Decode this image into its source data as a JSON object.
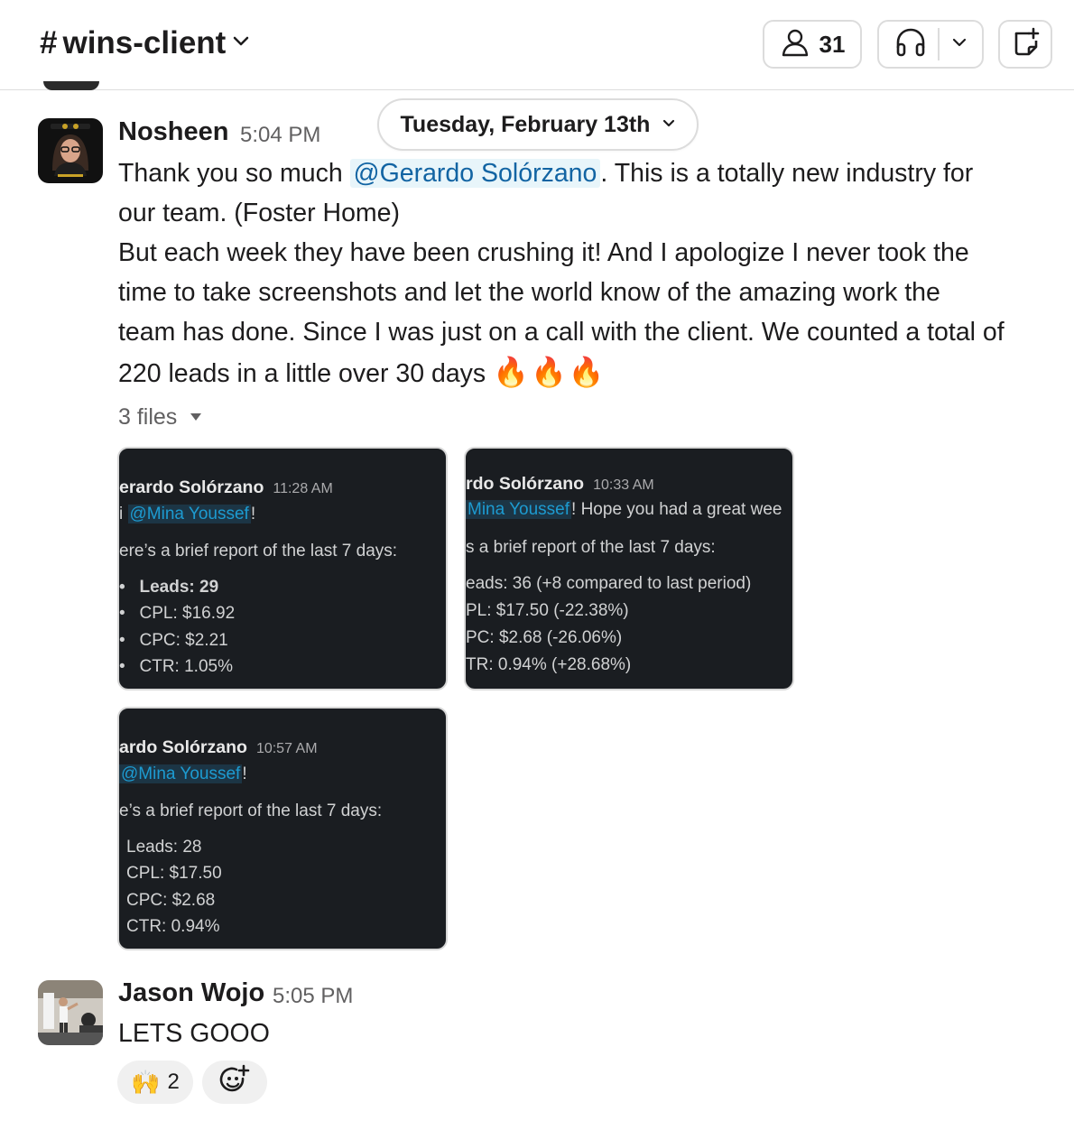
{
  "header": {
    "channel_hash": "#",
    "channel_name": "wins-client",
    "member_count": "31"
  },
  "date_divider": "Tuesday, February 13th",
  "messages": [
    {
      "author": "Nosheen",
      "time": "5:04 PM",
      "text_before": "Thank you so much ",
      "mention": "@Gerardo Solórzano",
      "text_after": ". This is a totally new industry for",
      "line2": "our team. (Foster Home)",
      "line3": "But each week they have been crushing it! And I apologize I never took the",
      "line4": "time to take screenshots and let the world know of the amazing work the",
      "line5": "team has done. Since I was just on a call with the client. We counted a total of",
      "line6": "220 leads in a little over 30 days",
      "emoji": "🔥🔥🔥",
      "files_label": "3 files",
      "attachments": [
        {
          "author": "erardo Solórzano",
          "time": "11:28 AM",
          "mention": "@Mina Youssef",
          "greeting_prefix": "i ",
          "greeting_suffix": "!",
          "intro": "ere’s a brief report of the last 7 days:",
          "stats": [
            "Leads: 29",
            "CPL: $16.92",
            "CPC: $2.21",
            "CTR: 1.05%"
          ]
        },
        {
          "author": "rdo Solórzano",
          "time": "10:33 AM",
          "mention": "Mina Youssef",
          "greeting_suffix": "! Hope you had a great wee",
          "intro": "s a brief report of the last 7 days:",
          "stats": [
            "eads: 36 (+8 compared to last period)",
            "PL: $17.50 (-22.38%)",
            "PC: $2.68 (-26.06%)",
            "TR: 0.94% (+28.68%)"
          ]
        },
        {
          "author": "ardo Solórzano",
          "time": "10:57 AM",
          "mention": "@Mina Youssef",
          "greeting_suffix": "!",
          "intro": "e’s a brief report of the last 7 days:",
          "stats": [
            "Leads: 28",
            "CPL: $17.50",
            "CPC: $2.68",
            "CTR: 0.94%"
          ]
        }
      ]
    },
    {
      "author": "Jason Wojo",
      "time": "5:05 PM",
      "text": "LETS GOOO",
      "reactions": [
        {
          "emoji": "🙌",
          "count": "2"
        }
      ]
    }
  ],
  "icons": {
    "members": "person-icon",
    "huddle": "headphones-icon",
    "canvas": "canvas-icon",
    "add_reaction": "add-reaction-icon"
  },
  "colors": {
    "mention": "#1264a3",
    "mention_bg": "#e8f5fa",
    "thumb_bg": "#1a1d21"
  }
}
